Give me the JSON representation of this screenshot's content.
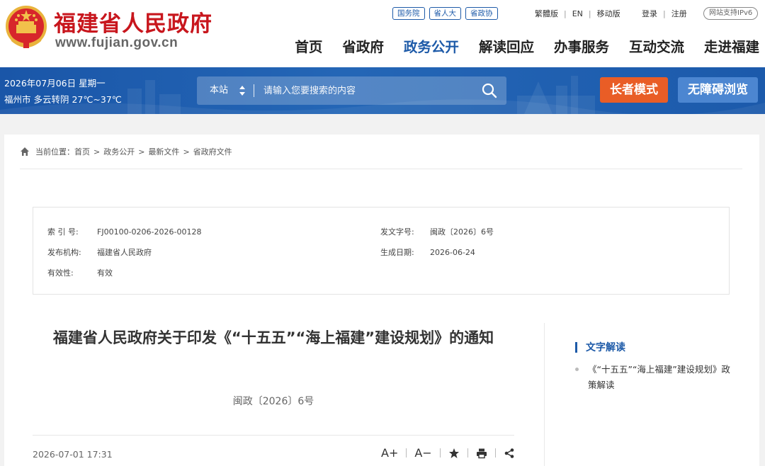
{
  "header": {
    "site_title": "福建省人民政府",
    "site_url": "www.fujian.gov.cn",
    "top_pills": [
      "国务院",
      "省人大",
      "省政协"
    ],
    "top_links": [
      "繁體版",
      "EN",
      "移动版"
    ],
    "login": "登录",
    "register": "注册",
    "ipv6": "网站支持IPv6",
    "nav": [
      "首页",
      "省政府",
      "政务公开",
      "解读回应",
      "办事服务",
      "互动交流",
      "走进福建"
    ],
    "active_nav": "政务公开"
  },
  "band": {
    "date": "2026年07月06日 星期一",
    "weather": "福州市 多云转阴 27℃~37℃",
    "search_scope": "本站",
    "search_placeholder": "请输入您要搜索的内容",
    "elder_mode": "长者模式",
    "accessible": "无障碍浏览"
  },
  "breadcrumb": {
    "prefix": "当前位置：",
    "items": [
      "首页",
      "政务公开",
      "最新文件",
      "省政府文件"
    ],
    "sep": ">"
  },
  "meta": {
    "index_label": "索 引 号:",
    "index_value": "FJ00100-0206-2026-00128",
    "docno_label": "发文字号:",
    "docno_value": "闽政〔2026〕6号",
    "org_label": "发布机构:",
    "org_value": "福建省人民政府",
    "date_label": "生成日期:",
    "date_value": "2026-06-24",
    "valid_label": "有效性:",
    "valid_value": "有效"
  },
  "doc": {
    "title": "福建省人民政府关于印发《“十五五”“海上福建”建设规划》的通知",
    "number": "闽政〔2026〕6号",
    "publish_time": "2026-07-01 17:31",
    "tool_font_plus": "A+",
    "tool_font_minus": "A−"
  },
  "sidebar": {
    "heading": "文字解读",
    "items": [
      "《“十五五”“海上福建”建设规划》政策解读"
    ]
  },
  "colors": {
    "brand_red": "#c8161d",
    "brand_blue": "#1d5aa8",
    "elder_orange": "#e95d26",
    "access_blue": "#4c86d1"
  }
}
